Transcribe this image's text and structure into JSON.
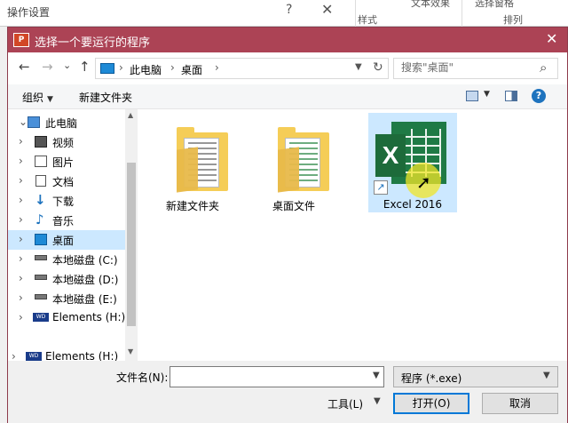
{
  "background_window": {
    "title": "操作设置",
    "help": "?",
    "close": "✕",
    "ribbon_group_1_top": "文本效果",
    "ribbon_group_1_bottom": "样式",
    "ribbon_group_2_top": "选择窗格",
    "ribbon_group_2_bottom": "排列"
  },
  "dialog": {
    "app_icon_text": "P",
    "title": "选择一个要运行的程序",
    "close": "✕"
  },
  "nav": {
    "back": "←",
    "forward": "→",
    "recent": "⌄",
    "up": "↑"
  },
  "address": {
    "crumbs": [
      "此电脑",
      "桌面"
    ],
    "separator": "›",
    "refresh": "↻"
  },
  "search": {
    "placeholder": "搜索\"桌面\""
  },
  "commandbar": {
    "organize": "组织",
    "new_folder": "新建文件夹",
    "help": "?"
  },
  "tree": {
    "items": [
      {
        "label": "此电脑",
        "expanded": true,
        "icon": "computer-icon"
      },
      {
        "label": "视频",
        "icon": "video-icon"
      },
      {
        "label": "图片",
        "icon": "pictures-icon"
      },
      {
        "label": "文档",
        "icon": "documents-icon"
      },
      {
        "label": "下载",
        "icon": "download-icon"
      },
      {
        "label": "音乐",
        "icon": "music-icon"
      },
      {
        "label": "桌面",
        "selected": true,
        "icon": "desktop-icon"
      },
      {
        "label": "本地磁盘 (C:)",
        "icon": "drive-icon"
      },
      {
        "label": "本地磁盘 (D:)",
        "icon": "drive-icon"
      },
      {
        "label": "本地磁盘 (E:)",
        "icon": "drive-icon"
      },
      {
        "label": "Elements (H:)",
        "icon": "wd-drive-icon"
      },
      {
        "label": "Elements (H:)",
        "icon": "wd-drive-icon"
      }
    ]
  },
  "files": [
    {
      "label": "新建文件夹",
      "type": "folder",
      "icon": "folder-icon"
    },
    {
      "label": "桌面文件",
      "type": "folder",
      "icon": "folder-icon"
    },
    {
      "label": "Excel 2016",
      "type": "shortcut",
      "icon": "excel-icon",
      "selected": true,
      "x_glyph": "X"
    }
  ],
  "bottom": {
    "filename_label": "文件名(N):",
    "filename_value": "",
    "file_type": "程序 (*.exe)",
    "tools": "工具(L)",
    "open": "打开(O)",
    "cancel": "取消"
  },
  "colors": {
    "titlebar": "#ac4355",
    "selection": "#cce8ff",
    "folder": "#f5cd57",
    "excel_green": "#1f7a45"
  }
}
